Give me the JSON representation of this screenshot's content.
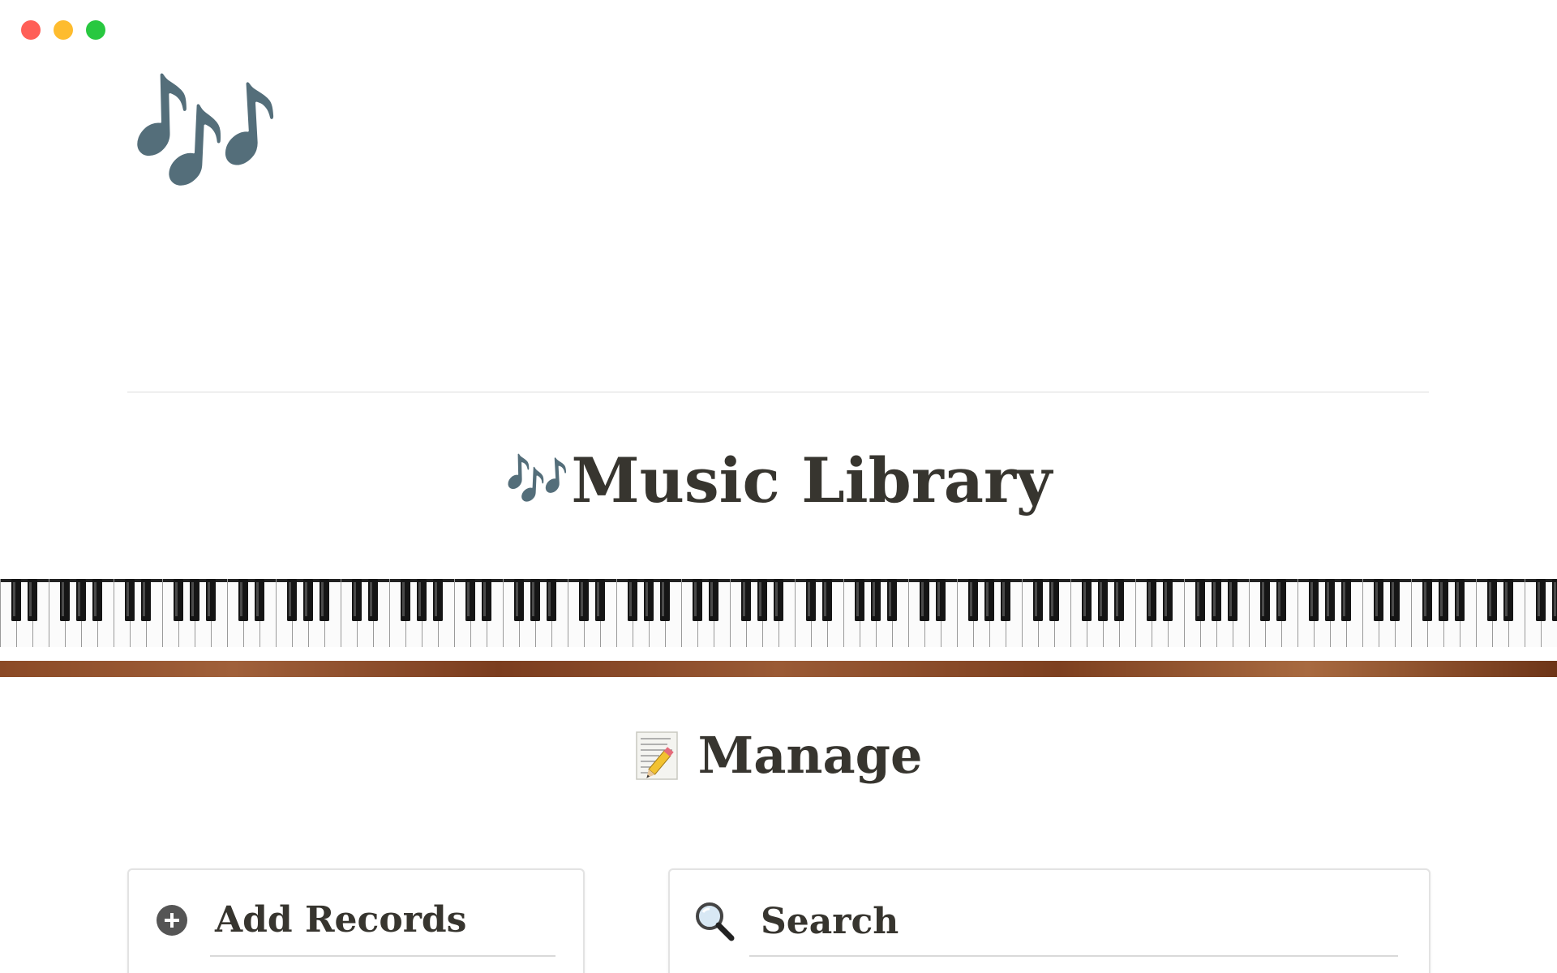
{
  "window": {
    "controls": {
      "close_color": "#ff5f57",
      "minimize_color": "#febc2e",
      "zoom_color": "#28c840"
    }
  },
  "page": {
    "icon": "🎶",
    "title_emoji": "🎶",
    "title": "Music Library",
    "banner": "piano-keyboard-banner"
  },
  "manage": {
    "emoji_name": "memo-icon",
    "heading": "Manage"
  },
  "cards": {
    "add": {
      "icon": "plus-circle-icon",
      "title": "Add Records"
    },
    "search": {
      "icon": "magnifier-icon",
      "title": "Search"
    }
  }
}
